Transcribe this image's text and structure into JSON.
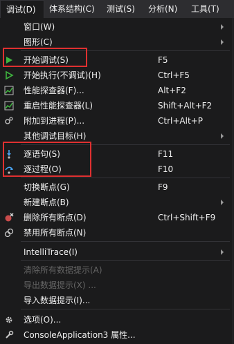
{
  "menubar": [
    "调试(D)",
    "体系结构(C)",
    "测试(S)",
    "分析(N)",
    "工具(T)"
  ],
  "menu": {
    "window": {
      "label": "窗口(W)"
    },
    "graphics": {
      "label": "图形(C)"
    },
    "start_debugging": {
      "label": "开始调试(S)",
      "shortcut": "F5"
    },
    "start_without": {
      "label": "开始执行(不调试)(H)",
      "shortcut": "Ctrl+F5"
    },
    "profiler": {
      "label": "性能探查器(F)...",
      "shortcut": "Alt+F2"
    },
    "restart_profiler": {
      "label": "重启性能探查器(L)",
      "shortcut": "Shift+Alt+F2"
    },
    "attach": {
      "label": "附加到进程(P)...",
      "shortcut": "Ctrl+Alt+P"
    },
    "other_targets": {
      "label": "其他调试目标(H)"
    },
    "step_into": {
      "label": "逐语句(S)",
      "shortcut": "F11"
    },
    "step_over": {
      "label": "逐过程(O)",
      "shortcut": "F10"
    },
    "toggle_bp": {
      "label": "切换断点(G)",
      "shortcut": "F9"
    },
    "new_bp": {
      "label": "新建断点(B)"
    },
    "delete_bp": {
      "label": "删除所有断点(D)",
      "shortcut": "Ctrl+Shift+F9"
    },
    "disable_bp": {
      "label": "禁用所有断点(N)"
    },
    "intellitrace": {
      "label": "IntelliTrace(I)"
    },
    "clear_datatips": {
      "label": "清除所有数据提示(A)"
    },
    "export_datatips": {
      "label": "导出数据提示(X) ..."
    },
    "import_datatips": {
      "label": "导入数据提示(I)..."
    },
    "options": {
      "label": "选项(O)..."
    },
    "properties": {
      "label": "ConsoleApplication3 属性..."
    }
  },
  "colors": {
    "highlight_box": "#e03030",
    "play_green": "#3fb63f",
    "disabled_text": "#656565"
  }
}
